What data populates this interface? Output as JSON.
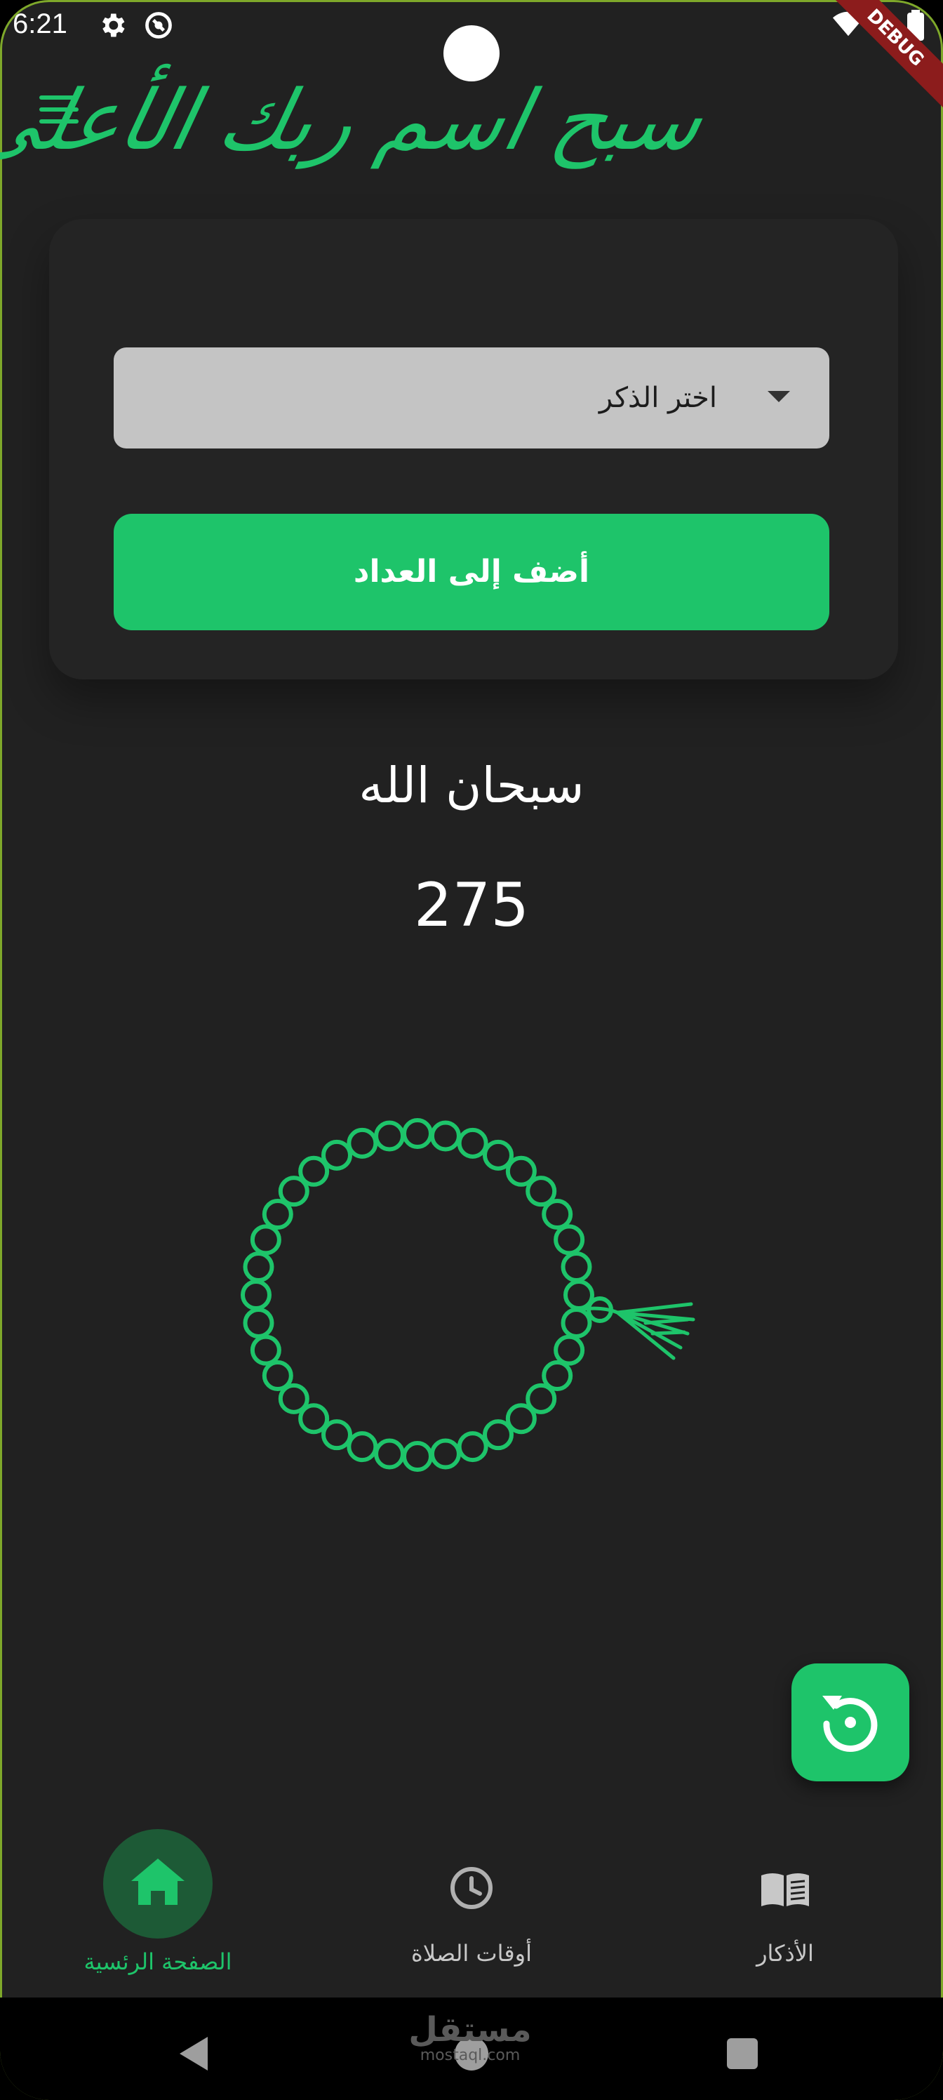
{
  "status_bar": {
    "time": "6:21",
    "debug_banner": "DEBUG"
  },
  "app_bar": {
    "menu_icon": "menu-icon",
    "logo_text": "سبح اسم ربك الأعلى"
  },
  "selector": {
    "dropdown_label": "اختر الذكر",
    "add_button_label": "أضف إلى العداد"
  },
  "counter": {
    "dhikr_name": "سبحان الله",
    "count": "275"
  },
  "fab": {
    "icon": "reset-icon"
  },
  "bottom_nav": {
    "items": [
      {
        "label": "الصفحة الرئسية",
        "icon": "home-icon",
        "active": true
      },
      {
        "label": "أوقات الصلاة",
        "icon": "clock-icon",
        "active": false
      },
      {
        "label": "الأذكار",
        "icon": "book-icon",
        "active": false
      }
    ]
  },
  "watermark": {
    "arabic": "مستقل",
    "latin": "mostaql.com"
  },
  "colors": {
    "accent": "#1ec46a",
    "background": "#212121",
    "card": "#242424",
    "dropdown": "#c4c4c4",
    "inactive": "#9e9e9e"
  }
}
